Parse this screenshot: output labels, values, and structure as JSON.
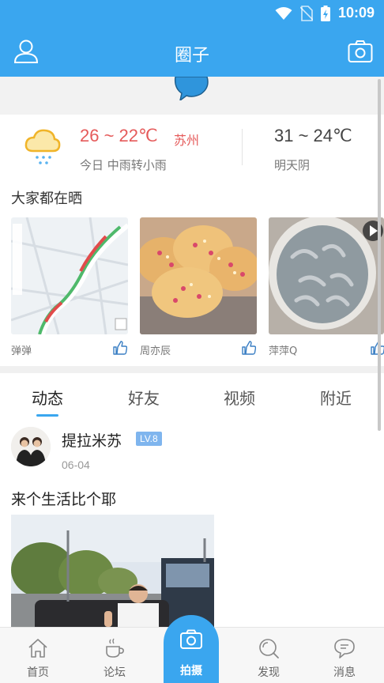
{
  "status_bar": {
    "time": "10:09",
    "icons": [
      "wifi-icon",
      "no-sim-icon",
      "battery-charging-icon"
    ]
  },
  "header": {
    "title": "圈子",
    "left_icon": "user-icon",
    "right_icon": "camera-icon"
  },
  "weather": {
    "today": {
      "temp": "26 ~ 22℃",
      "city": "苏州",
      "desc": "今日 中雨转小雨",
      "icon": "cloud-rain-icon"
    },
    "tomorrow": {
      "temp": "31 ~ 24℃",
      "desc": "明天阴"
    }
  },
  "showcase": {
    "title": "大家都在晒",
    "items": [
      {
        "user": "弹弹",
        "image": "map-screenshot"
      },
      {
        "user": "周亦辰",
        "image": "bread-photo"
      },
      {
        "user": "萍萍Q",
        "image": "shrimp-video"
      }
    ]
  },
  "tabs": [
    {
      "label": "动态",
      "active": true
    },
    {
      "label": "好友",
      "active": false
    },
    {
      "label": "视频",
      "active": false
    },
    {
      "label": "附近",
      "active": false
    }
  ],
  "post": {
    "username": "提拉米苏",
    "level": "LV.8",
    "date": "06-04",
    "text": "来个生活比个耶"
  },
  "bottom_nav": [
    {
      "label": "首页",
      "icon": "home-icon"
    },
    {
      "label": "论坛",
      "icon": "coffee-cup-icon"
    },
    {
      "label": "拍摄",
      "icon": "camera-icon"
    },
    {
      "label": "发现",
      "icon": "discover-icon"
    },
    {
      "label": "消息",
      "icon": "message-icon"
    }
  ],
  "colors": {
    "primary": "#3aa6ef",
    "temp_today": "#e55a5a",
    "level_badge": "#7fb5ee"
  }
}
